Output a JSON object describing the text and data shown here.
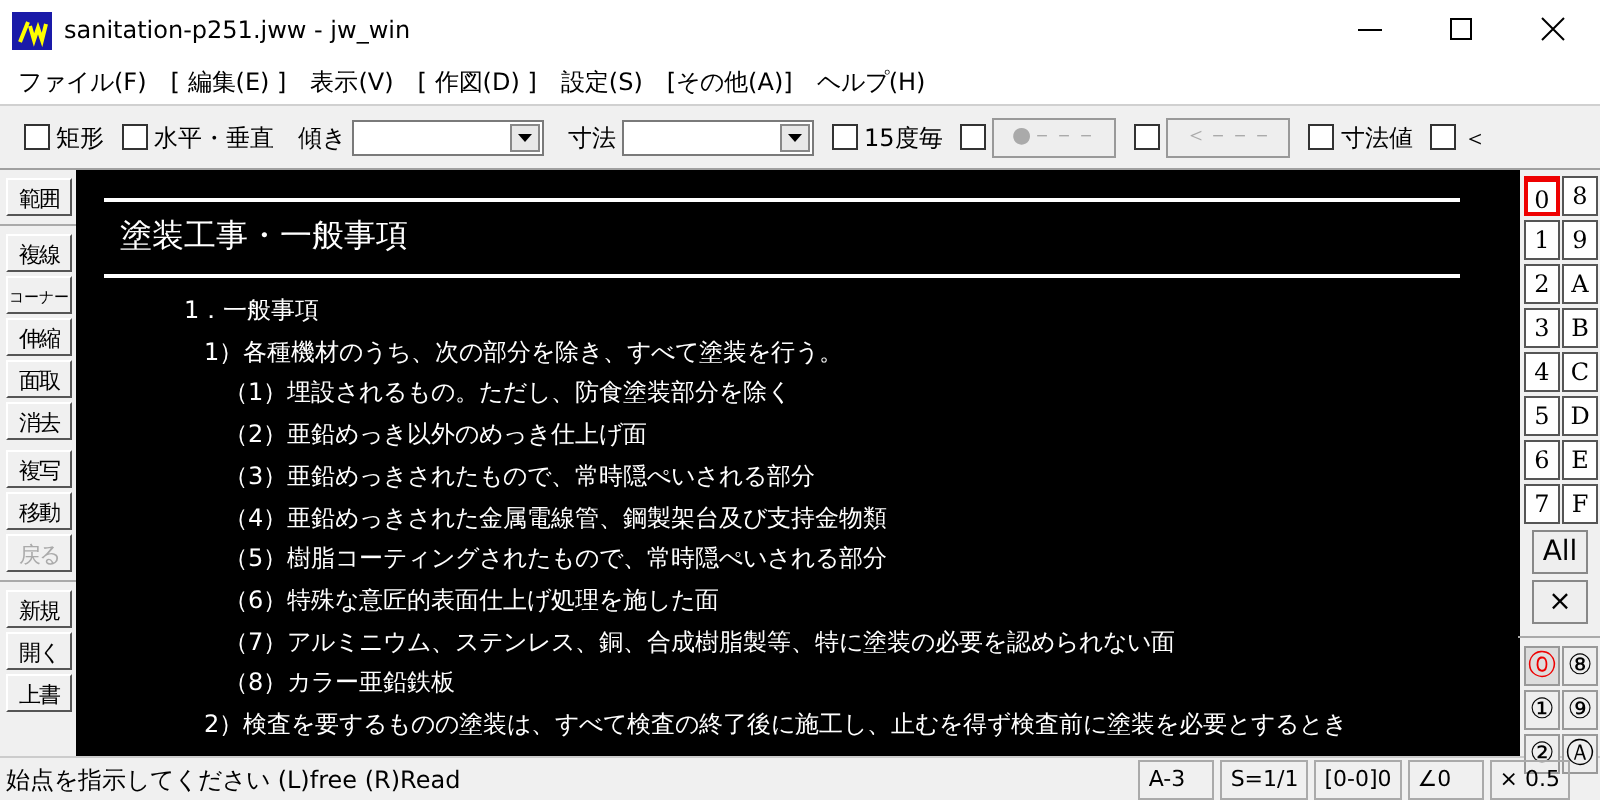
{
  "window": {
    "title": "sanitation-p251.jww - jw_win"
  },
  "menu": [
    "ファイル(F)",
    "[ 編集(E) ]",
    "表示(V)",
    "[ 作図(D) ]",
    "設定(S)",
    "[その他(A)]",
    "ヘルプ(H)"
  ],
  "toolbar": [
    {
      "kind": "checkbox",
      "label": "矩形",
      "checked": false
    },
    {
      "kind": "checkbox",
      "label": "水平・垂直",
      "checked": false
    },
    {
      "kind": "dropdown",
      "label": "傾き"
    },
    {
      "kind": "dropdown",
      "label": "寸法"
    },
    {
      "kind": "checkbox",
      "label": "15度毎",
      "checked": false
    },
    {
      "kind": "checkbutton",
      "label": "●－－－",
      "checked": false,
      "disabled": true
    },
    {
      "kind": "checkbutton",
      "label": "＜－－－",
      "checked": false,
      "disabled": true
    },
    {
      "kind": "checkbox",
      "label": "寸法値",
      "checked": false
    },
    {
      "kind": "checkbox",
      "label": "＜",
      "checked": false
    }
  ],
  "tools": [
    [
      {
        "label": "範囲",
        "disabled": false
      }
    ],
    [
      {
        "label": "複線",
        "disabled": false
      },
      {
        "label": "コーナー",
        "disabled": false
      },
      {
        "label": "伸縮",
        "disabled": false
      },
      {
        "label": "面取",
        "disabled": false
      },
      {
        "label": "消去",
        "disabled": false
      }
    ],
    [
      {
        "label": "複写",
        "disabled": false
      },
      {
        "label": "移動",
        "disabled": false
      },
      {
        "label": "戻る",
        "disabled": true
      }
    ],
    [
      {
        "label": "新規",
        "disabled": false
      },
      {
        "label": "開く",
        "disabled": false
      },
      {
        "label": "上書",
        "disabled": false
      }
    ]
  ],
  "drawing": {
    "heading": "塗装工事・一般事項",
    "lines": [
      {
        "text": "1．一般事項",
        "children": [
          {
            "text": "1）各種機材のうち、次の部分を除き、すべて塗装を行う。",
            "children": [
              {
                "text": "（1）埋設されるもの。ただし、防食塗装部分を除く"
              },
              {
                "text": "（2）亜鉛めっき以外のめっき仕上げ面"
              },
              {
                "text": "（3）亜鉛めっきされたもので、常時隠ぺいされる部分"
              },
              {
                "text": "（4）亜鉛めっきされた金属電線管、鋼製架台及び支持金物類"
              },
              {
                "text": "（5）樹脂コーティングされたもので、常時隠ぺいされる部分"
              },
              {
                "text": "（6）特殊な意匠的表面仕上げ処理を施した面"
              },
              {
                "text": "（7）アルミニウム、ステンレス、銅、合成樹脂製等、特に塗装の必要を認められない面"
              },
              {
                "text": "（8）カラー亜鉛鉄板"
              }
            ]
          },
          {
            "text": "2）検査を要するものの塗装は、すべて検査の終了後に施工し、止むを得ず検査前に塗装を必要とするとき"
          }
        ]
      }
    ]
  },
  "layers": [
    {
      "label": "0",
      "selected": true
    },
    {
      "label": "8",
      "selected": false
    },
    {
      "label": "1",
      "selected": false
    },
    {
      "label": "9",
      "selected": false
    },
    {
      "label": "2",
      "selected": false
    },
    {
      "label": "A",
      "selected": false
    },
    {
      "label": "3",
      "selected": false
    },
    {
      "label": "B",
      "selected": false
    },
    {
      "label": "4",
      "selected": false
    },
    {
      "label": "C",
      "selected": false
    },
    {
      "label": "5",
      "selected": false
    },
    {
      "label": "D",
      "selected": false
    },
    {
      "label": "6",
      "selected": false
    },
    {
      "label": "E",
      "selected": false
    },
    {
      "label": "7",
      "selected": false
    },
    {
      "label": "F",
      "selected": false
    }
  ],
  "layer_actions": [
    "All",
    "×"
  ],
  "layer_groups": [
    {
      "label": "⓪",
      "selected": true
    },
    {
      "label": "⑧",
      "selected": false
    },
    {
      "label": "①",
      "selected": false
    },
    {
      "label": "⑨",
      "selected": false
    },
    {
      "label": "②",
      "selected": false
    },
    {
      "label": "Ⓐ",
      "selected": false
    }
  ],
  "status_bar": {
    "message": "始点を指示してください (L)free (R)Read",
    "cells": [
      "A-3",
      "S=1/1",
      "[0-0]0",
      "∠0",
      "× 0.5"
    ]
  }
}
